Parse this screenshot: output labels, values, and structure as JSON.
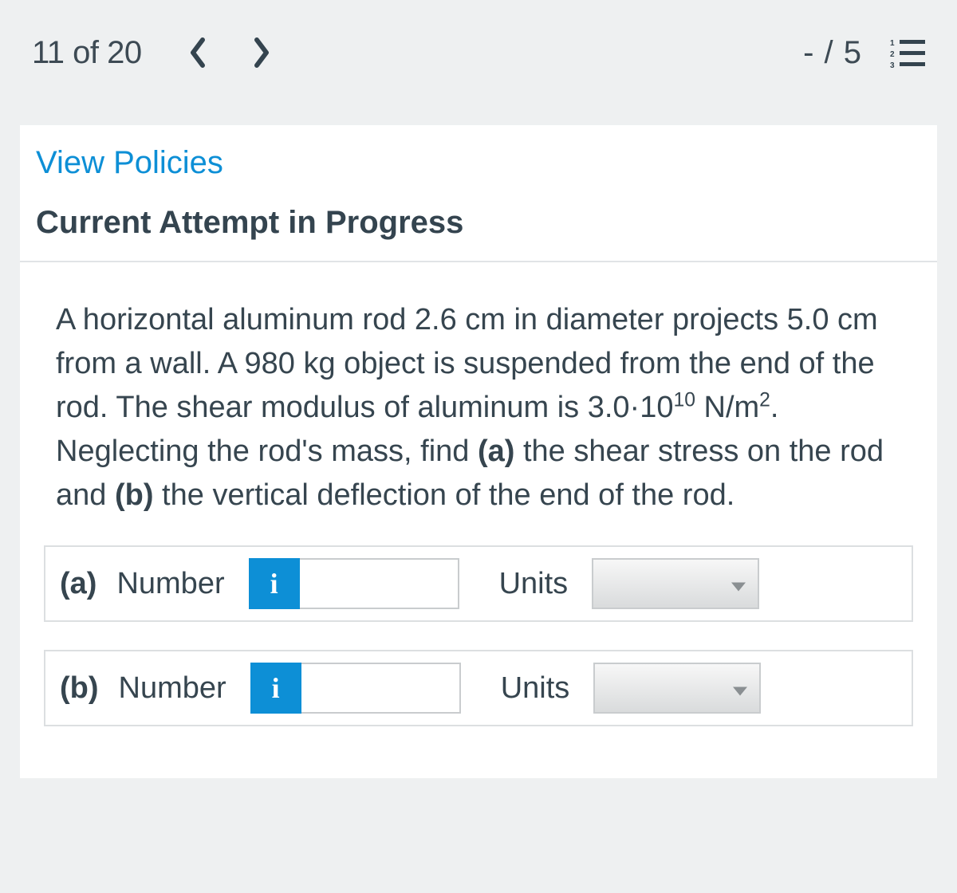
{
  "header": {
    "counter": "11 of 20",
    "score": "- / 5"
  },
  "policies_link": "View Policies",
  "attempt_title": "Current Attempt in Progress",
  "question": {
    "t1": "A horizontal aluminum rod 2.6 cm in diameter projects 5.0 cm from a wall. A 980 kg object is suspended from the end of the rod. The shear modulus of aluminum is 3.0·10",
    "sup1": "10",
    "t2": " N/m",
    "sup2": "2",
    "t3": ". Neglecting the rod's mass, find ",
    "bold_a": "(a)",
    "t4": " the shear stress on the rod and ",
    "bold_b": "(b)",
    "t5": " the vertical deflection of the end of the rod."
  },
  "answers": [
    {
      "part": "(a)",
      "number_label": "Number",
      "info": "i",
      "value": "",
      "units_label": "Units",
      "units_value": ""
    },
    {
      "part": "(b)",
      "number_label": "Number",
      "info": "i",
      "value": "",
      "units_label": "Units",
      "units_value": ""
    }
  ]
}
